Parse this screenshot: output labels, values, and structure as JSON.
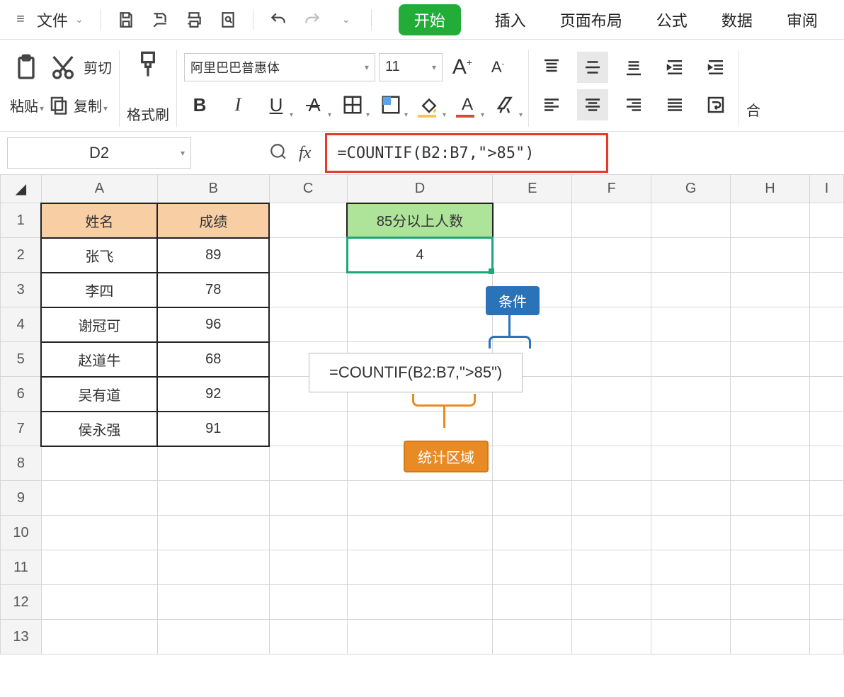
{
  "menu": {
    "file": "文件",
    "tabs": {
      "start": "开始",
      "insert": "插入",
      "layout": "页面布局",
      "formula": "公式",
      "data": "数据",
      "review": "审阅"
    }
  },
  "ribbon": {
    "paste": "粘贴",
    "cut": "剪切",
    "copy": "复制",
    "format_painter": "格式刷",
    "font_name": "阿里巴巴普惠体",
    "font_size": "11",
    "merge": "合"
  },
  "namebox": "D2",
  "formula": "=COUNTIF(B2:B7,\">85\")",
  "columns": [
    "A",
    "B",
    "C",
    "D",
    "E",
    "F",
    "G",
    "H",
    "I"
  ],
  "rows": [
    "1",
    "2",
    "3",
    "4",
    "5",
    "6",
    "7",
    "8",
    "9",
    "10",
    "11",
    "12",
    "13"
  ],
  "headerA": "姓名",
  "headerB": "成绩",
  "headerD": "85分以上人数",
  "d2value": "4",
  "tableData": [
    {
      "name": "张飞",
      "score": "89"
    },
    {
      "name": "李四",
      "score": "78"
    },
    {
      "name": "谢冠可",
      "score": "96"
    },
    {
      "name": "赵道牛",
      "score": "68"
    },
    {
      "name": "吴有道",
      "score": "92"
    },
    {
      "name": "侯永强",
      "score": "91"
    }
  ],
  "annotation": {
    "condition_label": "条件",
    "range_label": "统计区域",
    "formula_box": "=COUNTIF(B2:B7,\">85\")"
  }
}
